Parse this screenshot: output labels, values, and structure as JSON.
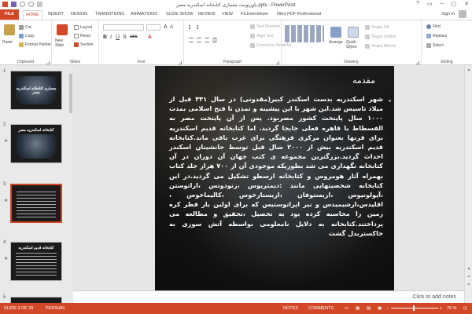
{
  "window": {
    "title": "پاورپوینت معماری کتابخانه اسکندریه مصر.pptx - PowerPoint"
  },
  "tabs": {
    "file": "FILE",
    "items": [
      "HOME",
      "INSERT",
      "DESIGN",
      "TRANSITIONS",
      "ANIMATIONS",
      "SLIDE SHOW",
      "REVIEW",
      "VIEW",
      "FILEminimizer",
      "Nitro PDF Professional"
    ],
    "sign_in": "Sign in"
  },
  "ribbon": {
    "clipboard": {
      "paste": "Paste",
      "cut": "Cut",
      "copy": "Copy",
      "format_painter": "Format Painter",
      "label": "Clipboard"
    },
    "slides": {
      "new_slide": "New Slide",
      "layout": "Layout",
      "reset": "Reset",
      "section": "Section",
      "label": "Slides"
    },
    "font": {
      "label": "Font"
    },
    "paragraph": {
      "text_direction": "Text Direction",
      "align_text": "Align Text",
      "convert_smartart": "Convert to SmartArt",
      "label": "Paragraph"
    },
    "drawing": {
      "arrange": "Arrange",
      "quick_styles": "Quick Styles",
      "shape_fill": "Shape Fill",
      "shape_outline": "Shape Outline",
      "shape_effects": "Shape Effects",
      "label": "Drawing"
    },
    "editing": {
      "find": "Find",
      "replace": "Replace",
      "select": "Select",
      "label": "Editing"
    }
  },
  "thumbnails": [
    {
      "num": "1",
      "title": "معماری کتابخانه اسکندریه مصر"
    },
    {
      "num": "2",
      "title": "کتابخانه اسکندریه مصر"
    },
    {
      "num": "3",
      "title": ""
    },
    {
      "num": "4",
      "title": "کتابخانه قدیم اسکندریه"
    },
    {
      "num": "5",
      "title": ""
    }
  ],
  "slide": {
    "heading": "مقدمه",
    "body": "شهر اسکندریه بدست اسکندر کبیر(مقدونی) در سال ۳۳۱ قبل از میلاد تاسیس شد.این شهر با این پیشینه و تمدن تا فتح اسلامی بمدت ۱۰۰۰ سال پایتخت کشور مصربود. پس از آن پایتخت مصر به الفسطاط یا قاهره فعلی جابجا گردید. اما کتابخانه قدیم اسکندریه برای قرنها بعنوان مرکزی فرهنگی برای غرب باقی ماند.کتابخانه قدیم اسکندریه بیش از ۲۰۰۰ سال قبل توسط جانشینان اسکندر احداث گردید.بزرگترین مجموعه ی کتب جهان آن دوران در آن کتابخانه نگهداری می شد بطوریکه موجودی آن از ۷۰۰ هزار جلد کتاب بهمراه آثار هومروس و کتابخانه ارسطو تشکیل می گردید.در این کتابخانه شخصیتهایی مانند :دیمتریوس ،زنودوتس ،اراتوستن ،آپولونیوس ،اریستوفان ،اریستارخوس ،کالیماخوس ، اقلیدس،ارشیمیدس و نیز اپراتوستیس که برای اولین بار قطر کره زمین را محاسبه کرده بود به تحصیل ،تحقیق و مطالعه می پرداختند.کتابخانه به دلایل نامعلومی بواسطه آتش سوزی به خاکستربدل گشت"
  },
  "notes_placeholder": "Click to add notes",
  "status": {
    "slide_info": "SLIDE 3 OF 39",
    "language": "PERSIAN",
    "notes": "NOTES",
    "comments": "COMMENTS",
    "zoom": "76 %"
  },
  "colors": {
    "accent": "#d24726",
    "slide_bg": "#111111"
  }
}
